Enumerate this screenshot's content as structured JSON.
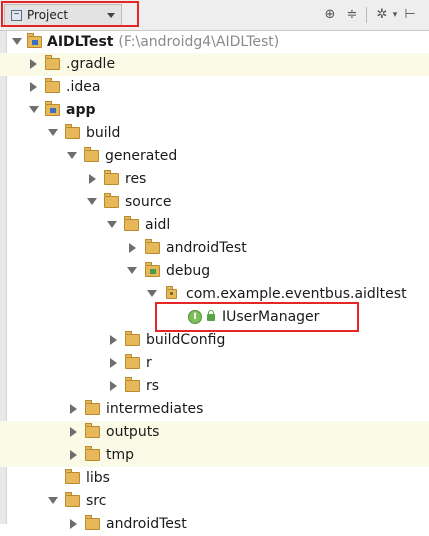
{
  "toolbar": {
    "view_selector": "Project",
    "icons": [
      "scroll-from-source-icon",
      "collapse-all-icon",
      "settings-icon",
      "hide-icon"
    ],
    "highlight_color": "#e52626"
  },
  "tree": [
    {
      "label": "AIDLTest",
      "path": "(F:\\androidg4\\AIDLTest)",
      "expanded": true,
      "bold": true,
      "icon": "project-folder-icon"
    },
    {
      "label": ".gradle",
      "expanded": false,
      "icon": "folder-icon"
    },
    {
      "label": ".idea",
      "expanded": false,
      "icon": "folder-icon"
    },
    {
      "label": "app",
      "expanded": true,
      "bold": true,
      "icon": "module-folder-icon"
    },
    {
      "label": "build",
      "expanded": true,
      "icon": "folder-icon"
    },
    {
      "label": "generated",
      "expanded": true,
      "icon": "folder-icon"
    },
    {
      "label": "res",
      "expanded": false,
      "icon": "folder-icon"
    },
    {
      "label": "source",
      "expanded": true,
      "icon": "folder-icon"
    },
    {
      "label": "aidl",
      "expanded": true,
      "icon": "folder-icon"
    },
    {
      "label": "androidTest",
      "expanded": false,
      "icon": "folder-icon"
    },
    {
      "label": "debug",
      "expanded": true,
      "icon": "source-folder-icon"
    },
    {
      "label": "com.example.eventbus.aidltest",
      "expanded": true,
      "icon": "package-icon"
    },
    {
      "label": "IUserManager",
      "icon": "interface-icon",
      "selected_highlight": true
    },
    {
      "label": "buildConfig",
      "expanded": false,
      "icon": "folder-icon"
    },
    {
      "label": "r",
      "expanded": false,
      "icon": "folder-icon"
    },
    {
      "label": "rs",
      "expanded": false,
      "icon": "folder-icon"
    },
    {
      "label": "intermediates",
      "expanded": false,
      "icon": "folder-icon"
    },
    {
      "label": "outputs",
      "expanded": false,
      "icon": "folder-icon"
    },
    {
      "label": "tmp",
      "expanded": false,
      "icon": "folder-icon"
    },
    {
      "label": "libs",
      "icon": "folder-icon"
    },
    {
      "label": "src",
      "expanded": true,
      "icon": "folder-icon"
    },
    {
      "label": "androidTest",
      "expanded": false,
      "icon": "folder-icon"
    }
  ],
  "colors": {
    "row_highlight": "#fbfae6",
    "folder": "#e6b85a"
  }
}
